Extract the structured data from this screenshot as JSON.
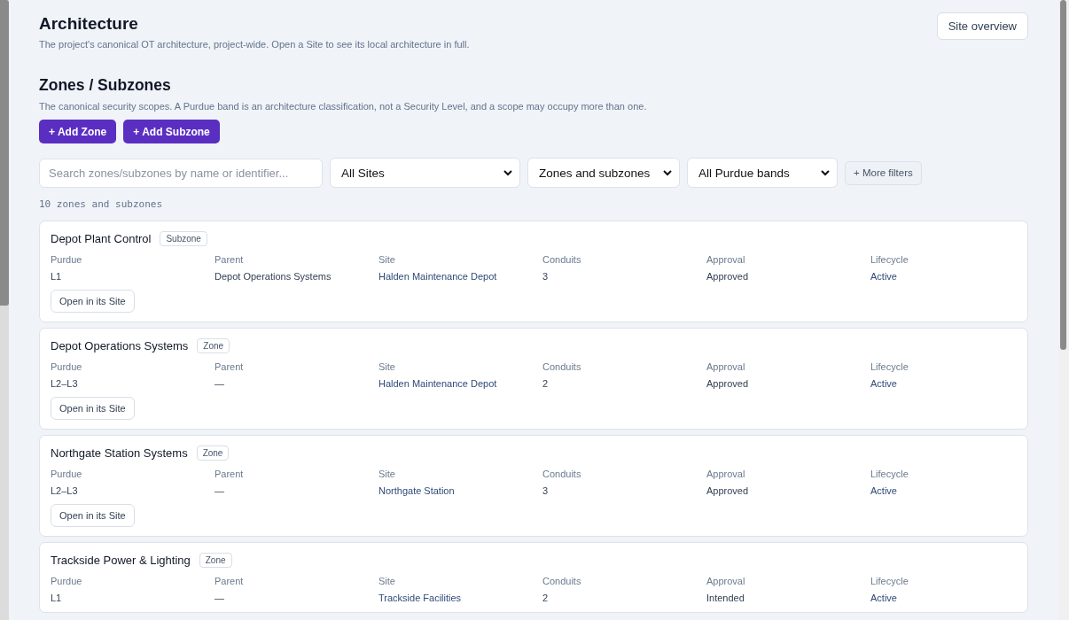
{
  "header": {
    "title": "Architecture",
    "subtitle": "The project's canonical OT architecture, project-wide. Open a Site to see its local architecture in full.",
    "button": "Site overview"
  },
  "section": {
    "title": "Zones / Subzones",
    "description": "The canonical security scopes. A Purdue band is an architecture classification, not a Security Level, and a scope may occupy more than one.",
    "buttons": [
      "+ Add Zone",
      "+ Add Subzone"
    ]
  },
  "filters": {
    "search": {
      "placeholder": "Search zones/subzones by name or identifier..."
    },
    "selects": [
      "All Sites",
      "Zones and subzones",
      "All Purdue bands"
    ],
    "more": "+ More filters"
  },
  "count": "10 zones and subzones",
  "cards": [
    {
      "name": "Depot Plant Control",
      "badge": "Subzone",
      "fields": [
        {
          "label": "Purdue",
          "value": "L1"
        },
        {
          "label": "Parent",
          "value": "Depot Operations Systems"
        },
        {
          "label": "Site",
          "value": "Halden Maintenance Depot"
        },
        {
          "label": "Conduits",
          "value": "3"
        },
        {
          "label": "Approval",
          "value": "Approved"
        },
        {
          "label": "Lifecycle",
          "value": "Active"
        }
      ],
      "action": "Open in its Site"
    },
    {
      "name": "Depot Operations Systems",
      "badge": "Zone",
      "fields": [
        {
          "label": "Purdue",
          "value": "L2–L3"
        },
        {
          "label": "Parent",
          "value": "—"
        },
        {
          "label": "Site",
          "value": "Halden Maintenance Depot"
        },
        {
          "label": "Conduits",
          "value": "2"
        },
        {
          "label": "Approval",
          "value": "Approved"
        },
        {
          "label": "Lifecycle",
          "value": "Active"
        }
      ],
      "action": "Open in its Site"
    },
    {
      "name": "Northgate Station Systems",
      "badge": "Zone",
      "fields": [
        {
          "label": "Purdue",
          "value": "L2–L3"
        },
        {
          "label": "Parent",
          "value": "—"
        },
        {
          "label": "Site",
          "value": "Northgate Station"
        },
        {
          "label": "Conduits",
          "value": "3"
        },
        {
          "label": "Approval",
          "value": "Approved"
        },
        {
          "label": "Lifecycle",
          "value": "Active"
        }
      ],
      "action": "Open in its Site"
    },
    {
      "name": "Trackside Power & Lighting",
      "badge": "Zone",
      "fields": [
        {
          "label": "Purdue",
          "value": "L1"
        },
        {
          "label": "Parent",
          "value": "—"
        },
        {
          "label": "Site",
          "value": "Trackside Facilities"
        },
        {
          "label": "Conduits",
          "value": "2"
        },
        {
          "label": "Approval",
          "value": "Intended"
        },
        {
          "label": "Lifecycle",
          "value": "Active"
        }
      ]
    }
  ]
}
